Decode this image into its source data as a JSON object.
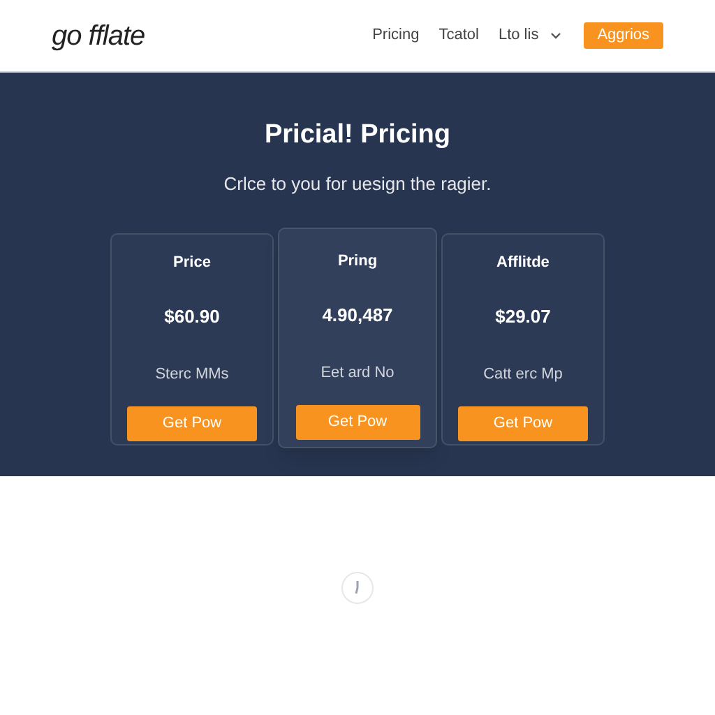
{
  "header": {
    "logo": "go fflate",
    "nav": [
      {
        "label": "Pricing",
        "dropdown": false
      },
      {
        "label": "Tcatol",
        "dropdown": false
      },
      {
        "label": "Lto lis",
        "dropdown": true
      }
    ],
    "cta": "Aggrios"
  },
  "hero": {
    "title": "Pricial! Pricing",
    "subtitle": "Crlce to you for uesign the ragier."
  },
  "plans": [
    {
      "name": "Price",
      "price": "$60.90",
      "note": "Sterc MMs",
      "button": "Get Pow",
      "featured": false
    },
    {
      "name": "Pring",
      "price": "4.90,487",
      "note": "Eet ard No",
      "button": "Get Pow",
      "featured": true
    },
    {
      "name": "Afflitde",
      "price": "$29.07",
      "note": "Catt erc Mp",
      "button": "Get Pow",
      "featured": false
    }
  ]
}
